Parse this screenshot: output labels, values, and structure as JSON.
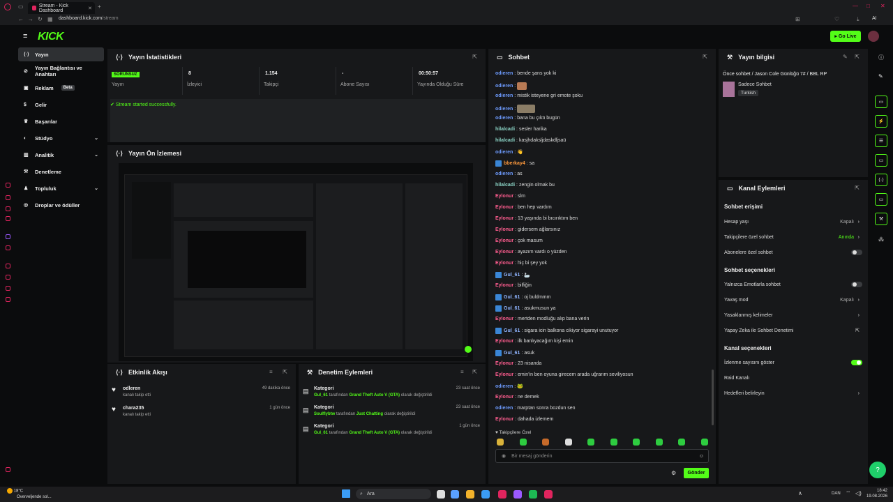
{
  "browser": {
    "tab_title": "Stream - Kick Dashboard",
    "address": "dashboard.kick.com/stream",
    "address_domain": "dashboard.kick.com",
    "address_path": "/stream",
    "ai_label": "AI"
  },
  "topbar": {
    "go_live": "Go Live"
  },
  "brand": {
    "logo": "KICK",
    "accent": "#53fc18"
  },
  "sidebar": {
    "items": [
      {
        "label": "Yayın",
        "icon": "broadcast-icon"
      },
      {
        "label": "Yayın Bağlantısı ve Anahtarı",
        "icon": "link-icon"
      },
      {
        "label": "Reklam",
        "badge": "Beta",
        "icon": "ad-icon"
      },
      {
        "label": "Gelir",
        "icon": "money-icon"
      },
      {
        "label": "Başarılar",
        "icon": "trophy-icon"
      },
      {
        "label": "Stüdyo",
        "icon": "studio-icon"
      },
      {
        "label": "Analitik",
        "icon": "chart-icon"
      },
      {
        "label": "Denetleme",
        "icon": "hammer-icon"
      },
      {
        "label": "Topluluk",
        "icon": "community-icon"
      },
      {
        "label": "Droplar ve ödüller",
        "icon": "gift-icon"
      }
    ]
  },
  "stats": {
    "title": "Yayın İstatistikleri",
    "status_badge": "SORUNSUZ",
    "status_label": "Yayın",
    "viewers": "8",
    "viewers_label": "İzleyici",
    "followers": "1.154",
    "followers_label": "Takipçi",
    "subs": "-",
    "subs_label": "Abone Sayısı",
    "duration": "00:50:57",
    "duration_label": "Yayında Olduğu Süre",
    "message": "Stream started successfully."
  },
  "preview": {
    "title": "Yayın Ön İzlemesi"
  },
  "activity": {
    "title": "Etkinlik Akışı",
    "items": [
      {
        "name": "odleren",
        "desc": "kanalı takip etti",
        "time": "49 dakika önce"
      },
      {
        "name": "chara235",
        "desc": "kanalı takip etti",
        "time": "1 gün önce"
      }
    ]
  },
  "modlog": {
    "title": "Denetim Eylemleri",
    "items": [
      {
        "title": "Kategori",
        "user": "Gul_61",
        "mid": "tarafından",
        "target": "Grand Theft Auto V (GTA)",
        "tail": "olarak değiştirildi",
        "time": "23 saat önce"
      },
      {
        "title": "Kategori",
        "user": "Soulflybtw",
        "mid": "tarafından",
        "target": "Just Chatting",
        "tail": "olarak değiştirildi",
        "time": "23 saat önce"
      },
      {
        "title": "Kategori",
        "user": "Gul_61",
        "mid": "tarafından",
        "target": "Grand Theft Auto V (GTA)",
        "tail": "olarak değiştirildi",
        "time": "1 gün önce"
      }
    ]
  },
  "chat": {
    "title": "Sohbet",
    "messages": [
      {
        "user": "odieren",
        "cls": "u-od",
        "text": "bende şans yok ki"
      },
      {
        "user": "odieren",
        "cls": "u-od",
        "text": "",
        "emote": "emote"
      },
      {
        "user": "odieren",
        "cls": "u-od",
        "text": "mistik isteyene gri emote şoku"
      },
      {
        "user": "odieren",
        "cls": "u-od",
        "text": "",
        "emote": "emote2"
      },
      {
        "user": "odieren",
        "cls": "u-od",
        "text": "bana bu çıktı bugün"
      },
      {
        "user": "hilalcadi",
        "cls": "u-hil",
        "text": "sesler harika"
      },
      {
        "user": "hilalcadi",
        "cls": "u-hil",
        "text": "kasjhdaksljdaskdljsaü"
      },
      {
        "user": "odieren",
        "cls": "u-od",
        "text": "👋"
      },
      {
        "user": "bberkay4",
        "cls": "u-ber",
        "text": "sa",
        "mod": true
      },
      {
        "user": "odieren",
        "cls": "u-od",
        "text": "as"
      },
      {
        "user": "hilalcadi",
        "cls": "u-hil",
        "text": "zengin olmak bu"
      },
      {
        "user": "Eylonur",
        "cls": "u-ey",
        "text": "slm"
      },
      {
        "user": "Eylonur",
        "cls": "u-ey",
        "text": "ben hep vardım"
      },
      {
        "user": "Eylonur",
        "cls": "u-ey",
        "text": "13 yaşında bi bıcırıktım ben"
      },
      {
        "user": "Eylonur",
        "cls": "u-ey",
        "text": "gidersem ağlarsınız"
      },
      {
        "user": "Eylonur",
        "cls": "u-ey",
        "text": "çok masum"
      },
      {
        "user": "Eylonur",
        "cls": "u-ey",
        "text": "ayazım vardı o yüzden"
      },
      {
        "user": "Eylonur",
        "cls": "u-ey",
        "text": "hiç bi şey yok"
      },
      {
        "user": "Gul_61",
        "cls": "u-gul",
        "text": "🦢",
        "mod": true
      },
      {
        "user": "Eylonur",
        "cls": "u-ey",
        "text": "bilfiğin"
      },
      {
        "user": "Gul_61",
        "cls": "u-gul",
        "text": "oj buldmmm",
        "mod": true
      },
      {
        "user": "Gul_61",
        "cls": "u-gul",
        "text": "asukmusun ya",
        "mod": true
      },
      {
        "user": "Eylonur",
        "cls": "u-ey",
        "text": "mertden modluğu alıp bana verin"
      },
      {
        "user": "Gul_61",
        "cls": "u-gul",
        "text": "sigara icin balkona cikiyor sigarayi unutuyor",
        "mod": true
      },
      {
        "user": "Eylonur",
        "cls": "u-ey",
        "text": "ilk banlıyacağım kişi emin"
      },
      {
        "user": "Gul_61",
        "cls": "u-gul",
        "text": "asuk",
        "mod": true
      },
      {
        "user": "Eylonur",
        "cls": "u-ey",
        "text": "23 nisanda"
      },
      {
        "user": "Eylonur",
        "cls": "u-ey",
        "text": "emin'in ben oyuna girecem arada uğrarım seviliyosun"
      },
      {
        "user": "odieren",
        "cls": "u-od",
        "text": "🐸"
      },
      {
        "user": "Eylonur",
        "cls": "u-ey",
        "text": "ne demek"
      },
      {
        "user": "odieren",
        "cls": "u-od",
        "text": "marptan sonra bozdun sen"
      },
      {
        "user": "Eylonur",
        "cls": "u-ey",
        "text": "dahada izlemem"
      }
    ],
    "followers_only": "Takipçilere Özel",
    "input_placeholder": "Bir mesaj gönderin",
    "send": "Gönder"
  },
  "streaminfo": {
    "title": "Yayın bilgisi",
    "stream_title": "Önce sohbet / Jason Cole Günlüğü 7# / BBL RP",
    "category": "Sadece Sohbet",
    "language": "Turkish"
  },
  "channel": {
    "title": "Kanal Eylemleri",
    "chat_access": "Sohbet erişimi",
    "account_age": "Hesap yaşı",
    "account_age_val": "Kapalı",
    "followers_chat": "Takipçilere özel sohbet",
    "followers_chat_val": "Anında",
    "subs_chat": "Abonelere özel sohbet",
    "chat_options": "Sohbet seçenekleri",
    "emote_only": "Yalnızca Emotlarla sohbet",
    "slow_mode": "Yavaş mod",
    "slow_mode_val": "Kapalı",
    "banned_words": "Yasaklanmış kelimeler",
    "ai_moderation": "Yapay Zeka ile Sohbet Denetimi",
    "channel_options": "Kanal seçenekleri",
    "show_viewers": "İzlenme sayısını göster",
    "raid": "Raid Kanalı",
    "goals": "Hedefleri belirleyin"
  },
  "taskbar": {
    "weather_temp": "18°C",
    "weather_desc": "Overveljende sol...",
    "search": "Ara",
    "lang": "DAN",
    "time": "18:42",
    "date": "19.08.2026"
  }
}
